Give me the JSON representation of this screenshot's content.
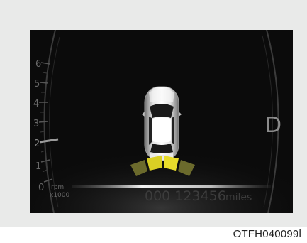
{
  "cluster": {
    "gear": "D",
    "odometer": {
      "value": "000 123456",
      "unit": "miles"
    },
    "tachometer": {
      "ticks": [
        "0",
        "1",
        "2",
        "3",
        "4",
        "5",
        "6"
      ],
      "unit_line1": "rpm",
      "unit_line2": "x1000"
    },
    "parking_sensor": {
      "active_zone": "rear",
      "segment_colors": [
        "#6b6a2c",
        "#d9cf24",
        "#e8dc2b",
        "#6b6a2c"
      ]
    }
  },
  "caption": "OTFH040099l"
}
